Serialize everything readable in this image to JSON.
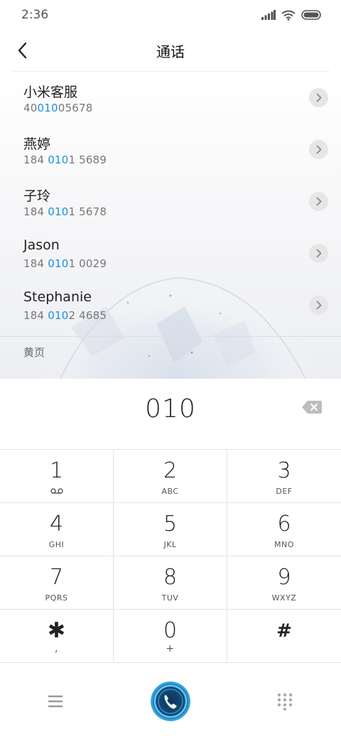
{
  "status": {
    "time": "2:36"
  },
  "header": {
    "title": "通话"
  },
  "contacts": [
    {
      "name": "小米客服",
      "num_pre": "40",
      "num_hl": "010",
      "num_post": "05678"
    },
    {
      "name": "燕婷",
      "num_pre": "184 ",
      "num_hl": "010",
      "num_post": "1 5689"
    },
    {
      "name": "子玲",
      "num_pre": "184 ",
      "num_hl": "010",
      "num_post": "1 5678"
    },
    {
      "name": "Jason",
      "num_pre": "184 ",
      "num_hl": "010",
      "num_post": "1 0029"
    },
    {
      "name": "Stephanie",
      "num_pre": "184 ",
      "num_hl": "010",
      "num_post": "2 4685"
    }
  ],
  "yellow_pages": "黄页",
  "dialed_number": "010",
  "keys": [
    {
      "digit": "1",
      "letters": ""
    },
    {
      "digit": "2",
      "letters": "ABC"
    },
    {
      "digit": "3",
      "letters": "DEF"
    },
    {
      "digit": "4",
      "letters": "GHI"
    },
    {
      "digit": "5",
      "letters": "JKL"
    },
    {
      "digit": "6",
      "letters": "MNO"
    },
    {
      "digit": "7",
      "letters": "PQRS"
    },
    {
      "digit": "8",
      "letters": "TUV"
    },
    {
      "digit": "9",
      "letters": "WXYZ"
    },
    {
      "digit": "✱",
      "letters": ","
    },
    {
      "digit": "0",
      "letters": "+"
    },
    {
      "digit": "#",
      "letters": ""
    }
  ],
  "icons": {
    "back": "chevron-left-icon",
    "voicemail": "voicemail-icon",
    "backspace": "backspace-icon",
    "menu": "menu-icon",
    "call": "phone-call-icon",
    "dialpad": "dialpad-icon"
  },
  "colors": {
    "highlight": "#1b8fe0",
    "call_glow": "#3fb6f2"
  }
}
